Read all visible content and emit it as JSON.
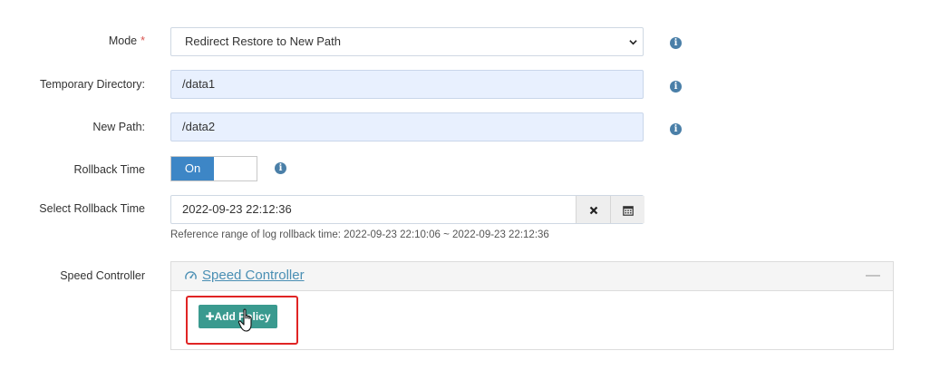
{
  "form": {
    "mode": {
      "label": "Mode",
      "required_mark": "*",
      "value": "Redirect Restore to New Path"
    },
    "temp_dir": {
      "label": "Temporary Directory:",
      "value": "/data1"
    },
    "new_path": {
      "label": "New Path:",
      "value": "/data2"
    },
    "rollback_time": {
      "label": "Rollback Time",
      "toggle_on_label": "On",
      "enabled": true
    },
    "select_rollback_time": {
      "label": "Select Rollback Time",
      "value": "2022-09-23 22:12:36",
      "clear_icon": "close-icon",
      "calendar_icon": "calendar-icon",
      "hint": "Reference range of log rollback time: 2022-09-23 22:10:06 ~ 2022-09-23 22:12:36"
    },
    "speed_controller": {
      "label": "Speed Controller",
      "panel_title": " Speed Controller",
      "collapse_symbol": "—",
      "add_policy_label": "✚Add Policy"
    },
    "info_icon_symbol": "i"
  },
  "colors": {
    "toggle_on": "#3d86c6",
    "add_button": "#3a9a8f",
    "panel_title": "#4a8fb4",
    "highlight": "#e02424",
    "info_icon": "#4a7fa8"
  }
}
